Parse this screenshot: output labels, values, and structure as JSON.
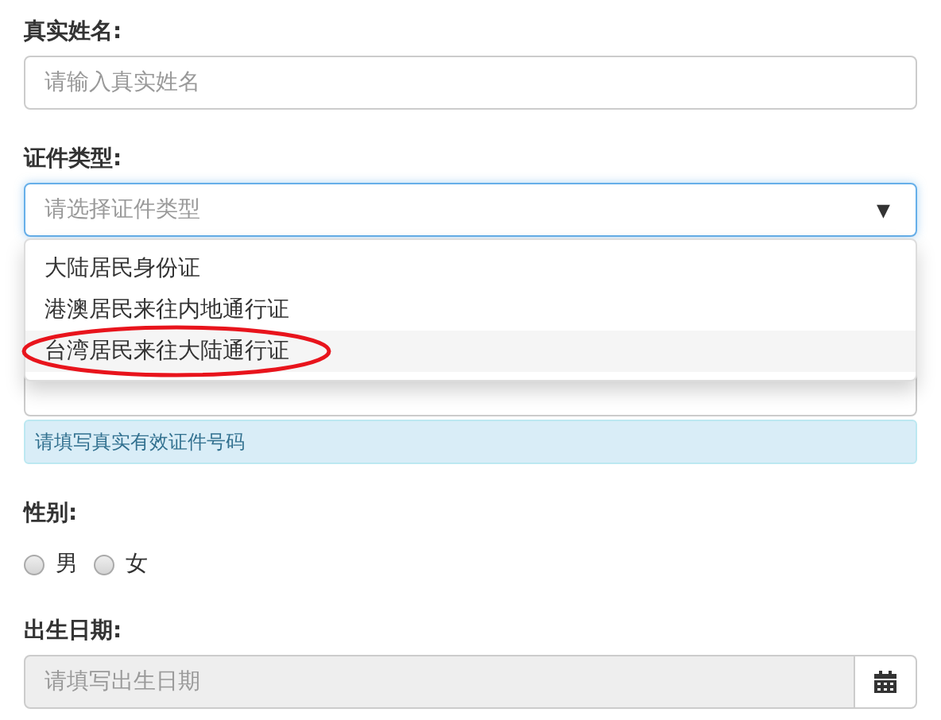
{
  "name_field": {
    "label": "真实姓名:",
    "placeholder": "请输入真实姓名"
  },
  "id_type": {
    "label": "证件类型:",
    "placeholder": "请选择证件类型",
    "caret": "▼",
    "expanded": true,
    "options": [
      {
        "label": "大陆居民身份证",
        "selected": false
      },
      {
        "label": "港澳居民来往内地通行证",
        "selected": false
      },
      {
        "label": "台湾居民来往大陆通行证",
        "selected": true,
        "circled": true
      }
    ]
  },
  "id_number": {
    "help": "请填写真实有效证件号码"
  },
  "gender": {
    "label": "性别:",
    "options": [
      {
        "label": "男",
        "checked": false
      },
      {
        "label": "女",
        "checked": false
      }
    ]
  },
  "birth_date": {
    "label": "出生日期:",
    "placeholder": "请填写出生日期"
  }
}
